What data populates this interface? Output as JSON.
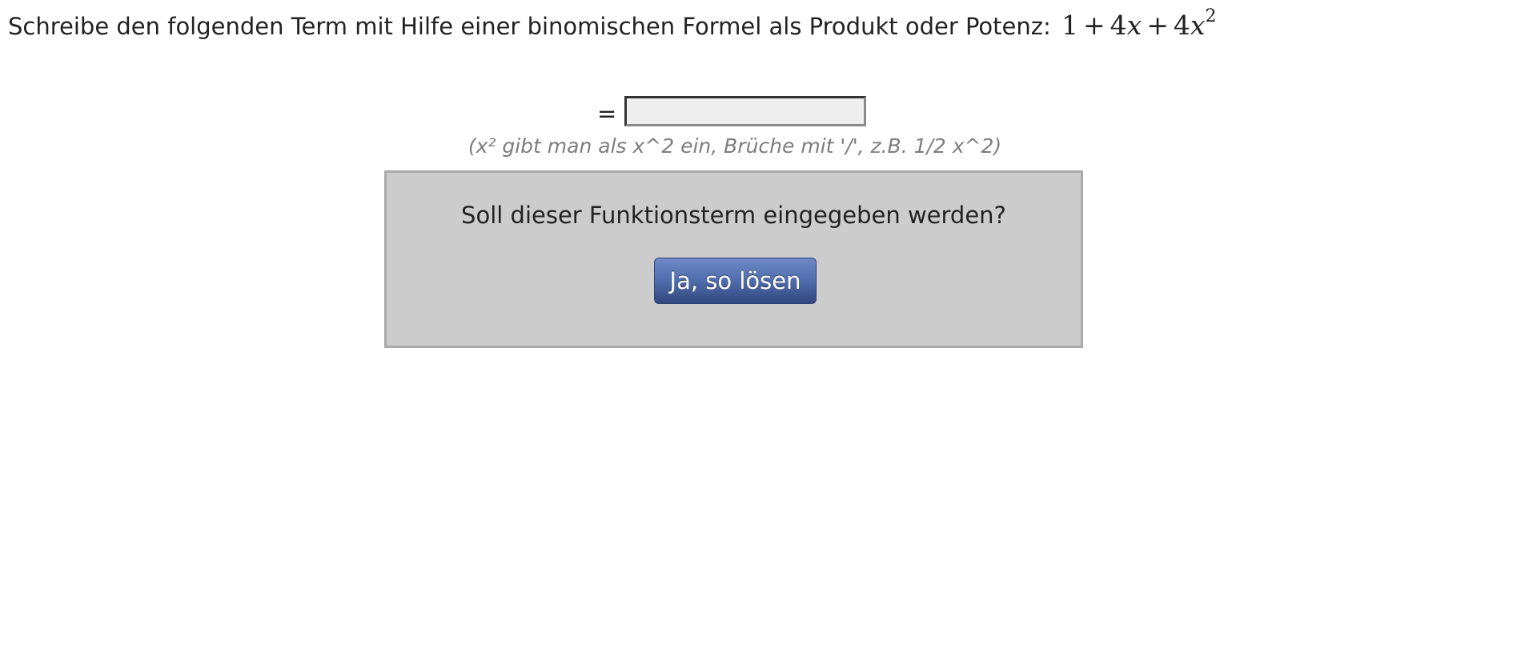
{
  "task": {
    "instruction": "Schreibe den folgenden Term mit Hilfe einer binomischen Formel als Produkt oder Potenz:",
    "formula": {
      "term1": "1",
      "op1": "+",
      "term2_coeff": "4",
      "term2_var": "x",
      "op2": "+",
      "term3_coeff": "4",
      "term3_var": "x",
      "term3_exp": "2"
    }
  },
  "answer": {
    "equals": "=",
    "value": "",
    "placeholder": ""
  },
  "hint": "(x² gibt man als x^2 ein, Brüche mit '/', z.B. 1/2 x^2)",
  "confirm": {
    "question": "Soll dieser Funktionsterm eingegeben werden?",
    "button_label": "Ja, so lösen"
  },
  "colors": {
    "button_top": "#6f89c6",
    "button_bottom": "#34487f",
    "box_background": "#cccccc",
    "hint_text": "#7d7d7d"
  }
}
